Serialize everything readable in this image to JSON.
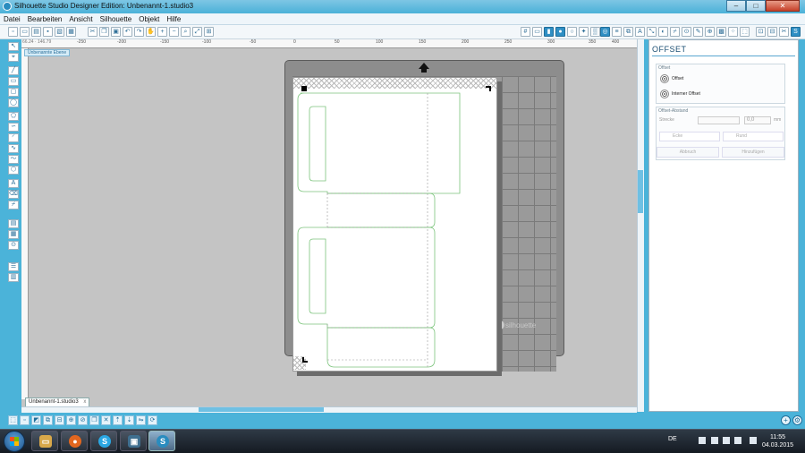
{
  "window": {
    "title": "Silhouette Studio Designer Edition: Unbenannt-1.studio3",
    "min_glyph": "–",
    "max_glyph": "□",
    "close_glyph": "✕"
  },
  "menu": [
    "Datei",
    "Bearbeiten",
    "Ansicht",
    "Silhouette",
    "Objekt",
    "Hilfe"
  ],
  "ruler": {
    "coords": "66.24 · 146.79",
    "ticks": [
      "-250",
      "-200",
      "-150",
      "-100",
      "-50",
      "0",
      "50",
      "100",
      "150",
      "200",
      "250",
      "300",
      "350",
      "400",
      "450",
      "500"
    ]
  },
  "canvas": {
    "layer_label": "Unbenannte Ebene",
    "brand": "silhouette"
  },
  "document": {
    "tab_label": "Unbenannt-1.studio3",
    "tab_close": "x"
  },
  "offset_panel": {
    "title": "OFFSET",
    "group_offset": "Offset",
    "option_offset": "Offset",
    "option_internal": "Interner Offset",
    "group_distance": "Offset-Abstand",
    "distance_label": "Strecke",
    "distance_value": "0,0",
    "distance_unit": "mm",
    "corner_edge": "Ecke",
    "corner_round": "Rund",
    "apply_button": "Abbruch",
    "add_button": "Hinzufügen"
  },
  "taskbar": {
    "language": "DE",
    "time": "11:55",
    "date": "04.03.2015"
  },
  "colors": {
    "accent": "#4bb3d9",
    "cut_line": "#7cc47c",
    "mat": "#8d8d8d"
  }
}
